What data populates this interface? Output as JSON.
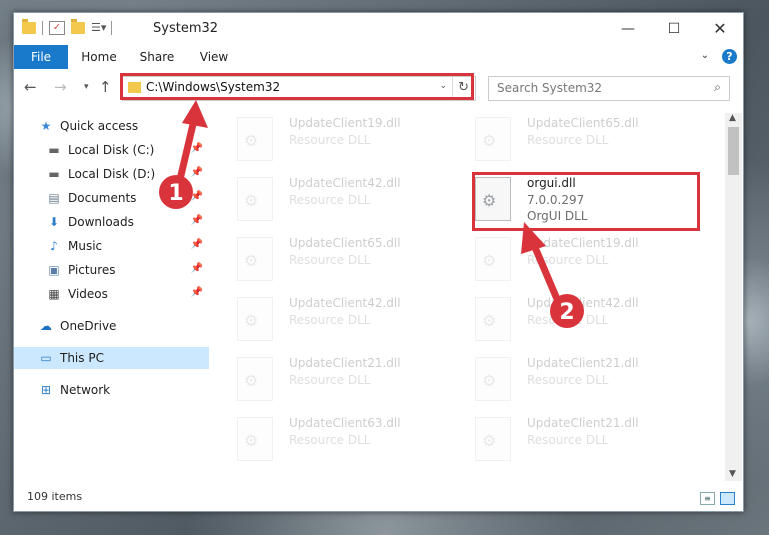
{
  "window": {
    "title": "System32",
    "controls": {
      "minimize": "—",
      "maximize": "☐",
      "close": "✕"
    }
  },
  "ribbon": {
    "tabs": [
      "File",
      "Home",
      "Share",
      "View"
    ],
    "help": "?"
  },
  "nav": {
    "address": "C:\\Windows\\System32",
    "search_placeholder": "Search System32"
  },
  "sidebar": {
    "items": [
      {
        "label": "Quick access",
        "icon": "star-icon",
        "pinned": false
      },
      {
        "label": "Local Disk (C:)",
        "icon": "drive-icon",
        "pinned": true
      },
      {
        "label": "Local Disk (D:)",
        "icon": "drive-icon",
        "pinned": true
      },
      {
        "label": "Documents",
        "icon": "documents-icon",
        "pinned": true
      },
      {
        "label": "Downloads",
        "icon": "download-icon",
        "pinned": true
      },
      {
        "label": "Music",
        "icon": "music-icon",
        "pinned": true
      },
      {
        "label": "Pictures",
        "icon": "pictures-icon",
        "pinned": true
      },
      {
        "label": "Videos",
        "icon": "video-icon",
        "pinned": true
      },
      {
        "label": "OneDrive",
        "icon": "cloud-icon",
        "pinned": false
      },
      {
        "label": "This PC",
        "icon": "computer-icon",
        "pinned": false,
        "selected": true
      },
      {
        "label": "Network",
        "icon": "network-icon",
        "pinned": false
      }
    ]
  },
  "files": {
    "left_column": [
      {
        "name": "UpdateClient19.dll",
        "desc": "Resource DLL"
      },
      {
        "name": "UpdateClient42.dll",
        "desc": "Resource DLL"
      },
      {
        "name": "UpdateClient65.dll",
        "desc": "Resource DLL"
      },
      {
        "name": "UpdateClient42.dll",
        "desc": "Resource DLL"
      },
      {
        "name": "UpdateClient21.dll",
        "desc": "Resource DLL"
      },
      {
        "name": "UpdateClient63.dll",
        "desc": "Resource DLL"
      }
    ],
    "right_column": [
      {
        "name": "UpdateClient65.dll",
        "desc": "Resource DLL"
      },
      {
        "name": "UpdateClient19.dll",
        "desc": "Resource DLL"
      },
      {
        "name": "UpdateClient42.dll",
        "desc": "Resource DLL"
      },
      {
        "name": "UpdateClient21.dll",
        "desc": "Resource DLL"
      },
      {
        "name": "UpdateClient21.dll",
        "desc": "Resource DLL"
      }
    ],
    "highlighted": {
      "name": "orgui.dll",
      "version": "7.0.0.297",
      "desc": "OrgUI DLL"
    }
  },
  "status": {
    "items_count": "109 items"
  },
  "annotations": {
    "step1": "1",
    "step2": "2",
    "color": "#d9343b"
  }
}
